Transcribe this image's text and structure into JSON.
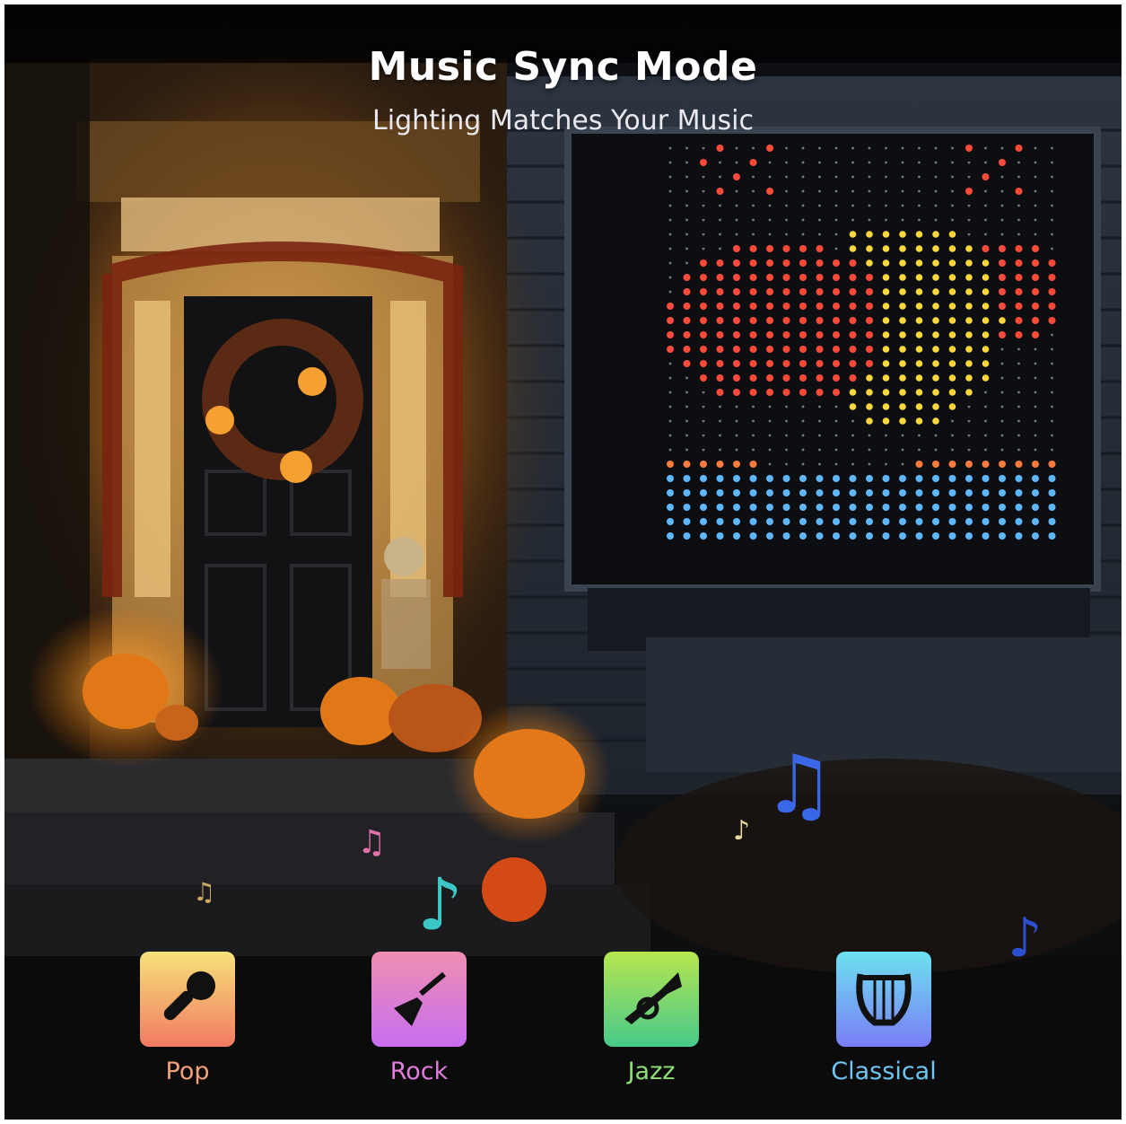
{
  "header": {
    "title": "Music Sync Mode",
    "subtitle": "Lighting Matches Your Music"
  },
  "genres": [
    {
      "label": "Pop",
      "icon": "microphone-icon",
      "color": "#f4a07a",
      "gradient": [
        "#f6e27a",
        "#f27a63"
      ]
    },
    {
      "label": "Rock",
      "icon": "guitar-icon",
      "color": "#e07ee0",
      "gradient": [
        "#ef8fb1",
        "#c76df0"
      ]
    },
    {
      "label": "Jazz",
      "icon": "trumpet-icon",
      "color": "#8fe07a",
      "gradient": [
        "#b6e64f",
        "#47c98a"
      ]
    },
    {
      "label": "Classical",
      "icon": "lyre-icon",
      "color": "#6fc6f2",
      "gradient": [
        "#6de2f0",
        "#7a7cf5"
      ]
    }
  ],
  "colors": {
    "led_red": "#ff4a3a",
    "led_orange": "#ff7a3c",
    "led_yellow": "#ffd83a",
    "led_blue": "#5fb8ff",
    "pumpkin": "#f08a1e"
  }
}
